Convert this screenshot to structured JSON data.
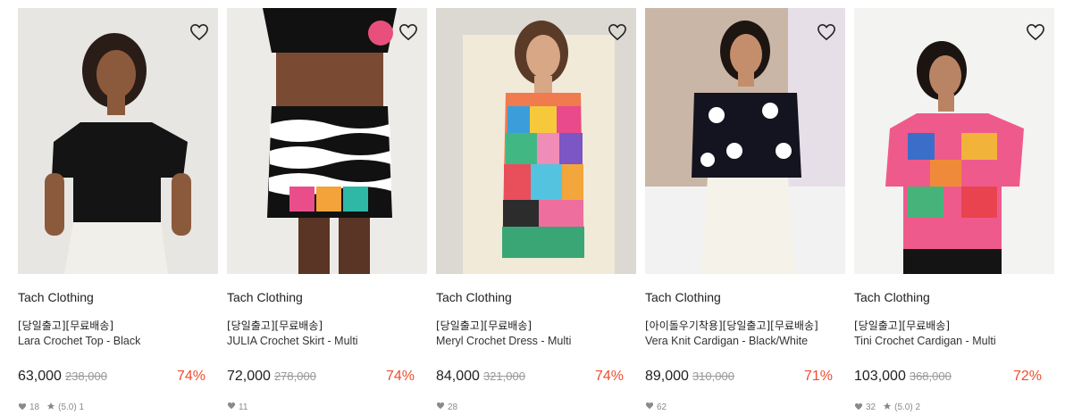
{
  "products": [
    {
      "brand": "Tach Clothing",
      "tags": "[당일출고][무료배송]",
      "name": "Lara Crochet Top - Black",
      "price": "63,000",
      "original_price": "238,000",
      "discount": "74%",
      "likes": "18",
      "rating": "(5.0)",
      "reviews": "1"
    },
    {
      "brand": "Tach Clothing",
      "tags": "[당일출고][무료배송]",
      "name": "JULIA Crochet Skirt - Multi",
      "price": "72,000",
      "original_price": "278,000",
      "discount": "74%",
      "likes": "11"
    },
    {
      "brand": "Tach Clothing",
      "tags": "[당일출고][무료배송]",
      "name": "Meryl Crochet Dress - Multi",
      "price": "84,000",
      "original_price": "321,000",
      "discount": "74%",
      "likes": "28"
    },
    {
      "brand": "Tach Clothing",
      "tags": "[아이돌우기착용][당일출고][무료배송]",
      "name": "Vera Knit Cardigan - Black/White",
      "price": "89,000",
      "original_price": "310,000",
      "discount": "71%",
      "likes": "62"
    },
    {
      "brand": "Tach Clothing",
      "tags": "[당일출고][무료배송]",
      "name": "Tini Crochet Cardigan - Multi",
      "price": "103,000",
      "original_price": "368,000",
      "discount": "72%",
      "likes": "32",
      "rating": "(5.0)",
      "reviews": "2"
    }
  ],
  "icons": {
    "wishlist": "heart-outline-icon",
    "likes": "heart-filled-icon",
    "rating": "star-icon"
  },
  "colors": {
    "discount": "#ee4d2d",
    "strike": "#999999",
    "meta": "#8a8a8a"
  }
}
